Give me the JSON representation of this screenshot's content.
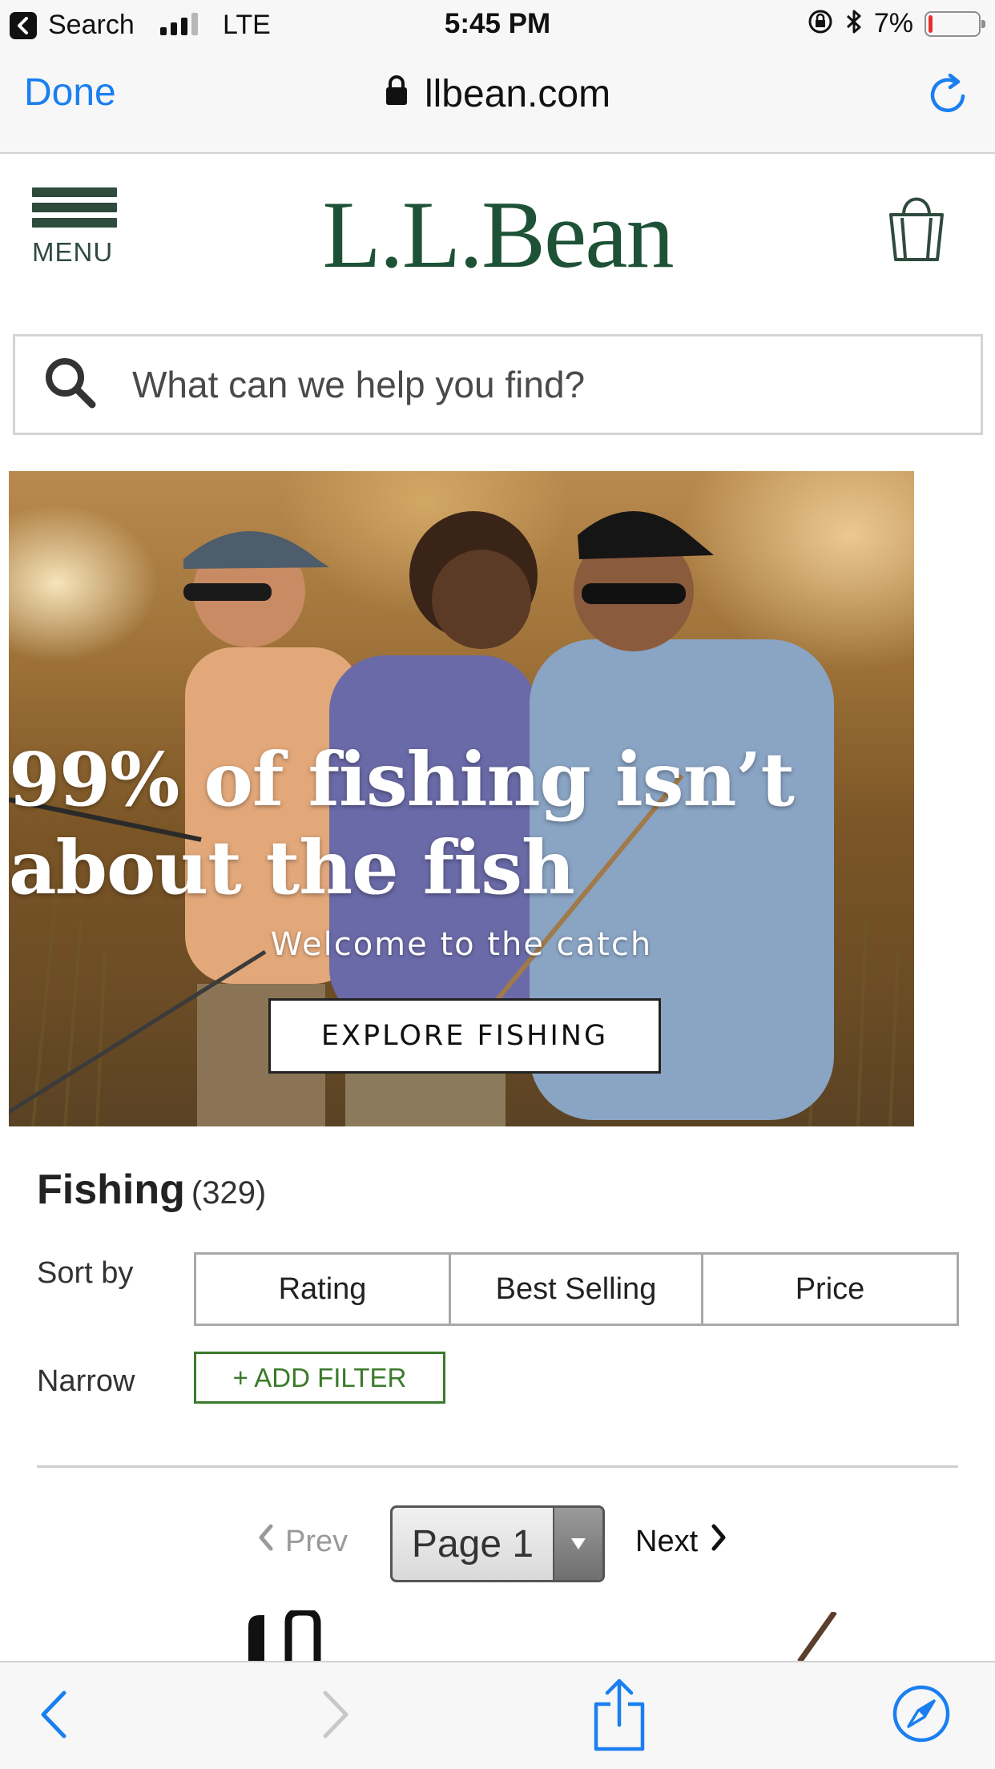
{
  "status_bar": {
    "back_app_label": "Search",
    "network": "LTE",
    "time": "5:45 PM",
    "battery_percent": "7%",
    "battery_level": 0.07,
    "battery_color": "#e5322d"
  },
  "browser_bar": {
    "done_label": "Done",
    "url": "llbean.com",
    "accent_color": "#1a7ff0"
  },
  "header": {
    "menu_label": "MENU",
    "logo_text": "L.L.Bean",
    "brand_color": "#1d5236"
  },
  "search": {
    "placeholder": "What can we help you find?"
  },
  "hero": {
    "headline_line1": "99% of fishing isn’t",
    "headline_line2": "about the fish",
    "subtitle": "Welcome to the catch",
    "cta_label": "EXPLORE FISHING"
  },
  "category": {
    "title": "Fishing",
    "count": "(329)",
    "sort_label": "Sort by",
    "sort_options": [
      "Rating",
      "Best Selling",
      "Price"
    ],
    "narrow_label": "Narrow",
    "add_filter_label": "+ ADD FILTER",
    "filter_color": "#3a7a2a"
  },
  "pagination": {
    "prev_label": "Prev",
    "current_page": "Page 1",
    "next_label": "Next"
  },
  "toolbar": {
    "icons": [
      "back-icon",
      "forward-icon",
      "share-icon",
      "compass-icon"
    ]
  }
}
